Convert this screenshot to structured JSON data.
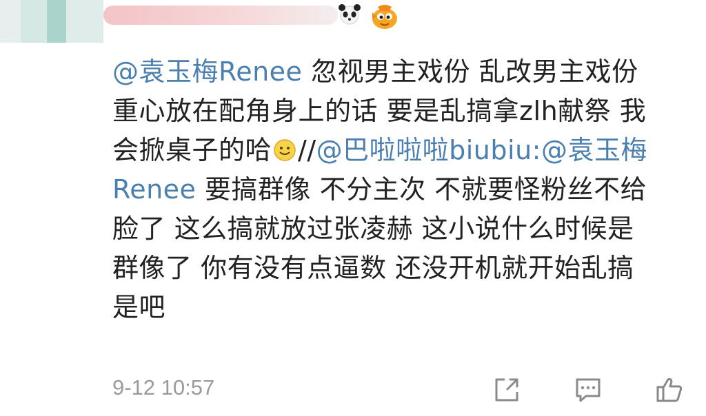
{
  "comment": {
    "mention_1": "@袁玉梅Renee",
    "line_1_text": "忽视男主戏份 乱改男主戏份",
    "line_2_text": "重心放在配角身上的话 要是乱搞拿zlh献祭 我",
    "line_3_text": "会掀桌子的哈",
    "repost_sep": "//",
    "mention_2": "@巴啦啦啦biubiu",
    "colon": ":",
    "mention_3a": "@袁玉梅",
    "mention_3b": "Renee",
    "line_4_text": "要搞群像 不分主次 不就要怪粉丝不给",
    "line_5_text": "脸了 这么搞就放过张凌赫 这小说什么时候是",
    "line_6_text": "群像了 你有没有点逼数 还没开机就开始乱搞",
    "line_7_text": "是吧"
  },
  "footer": {
    "timestamp": "9-12 10:57",
    "share_icon": "share-icon",
    "comment_icon": "comment-icon",
    "like_icon": "thumbs-up-icon"
  },
  "colors": {
    "mention": "#4a7fb0",
    "text": "#222222",
    "timestamp": "#9a9a9a",
    "icon": "#8a8a8a"
  }
}
